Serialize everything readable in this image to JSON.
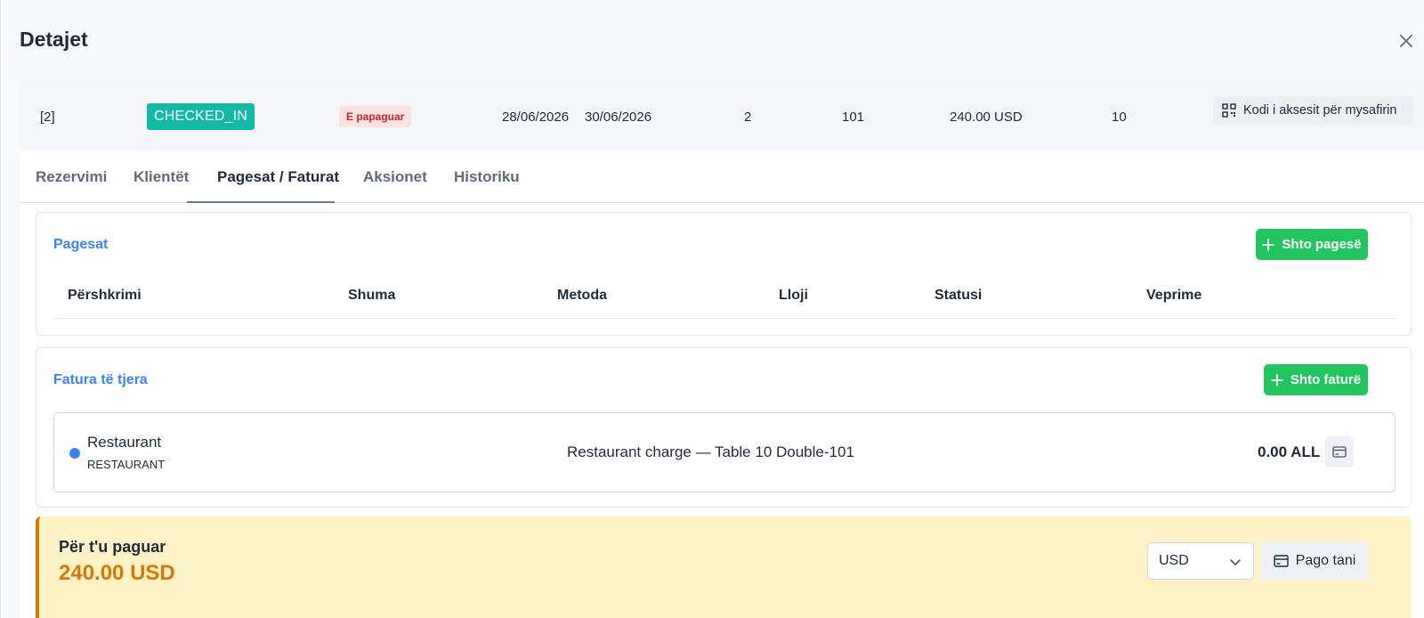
{
  "modal": {
    "title": "Detajet"
  },
  "summary": {
    "reservation_id": "[2]",
    "status": "CHECKED_IN",
    "payment_status": "E papaguar",
    "date_from": "28/06/2026",
    "date_to": "30/06/2026",
    "guests": "2",
    "room": "101",
    "price": "240.00 USD",
    "nights": "10",
    "access_code_label": "Kodi i aksesit për mysafirin"
  },
  "tabs": [
    {
      "label": "Rezervimi"
    },
    {
      "label": "Klientët"
    },
    {
      "label": "Pagesat / Faturat",
      "active": true
    },
    {
      "label": "Aksionet"
    },
    {
      "label": "Historiku"
    }
  ],
  "payments": {
    "title": "Pagesat",
    "add_label": "Shto pagesë",
    "columns": [
      "Përshkrimi",
      "Shuma",
      "Metoda",
      "Lloji",
      "Statusi",
      "Veprime"
    ]
  },
  "other_invoices": {
    "title": "Fatura të tjera",
    "add_label": "Shto faturë",
    "items": [
      {
        "name": "Restaurant",
        "type": "RESTAURANT",
        "description": "Restaurant charge — Table 10",
        "room": "Double-101",
        "amount": "0.00 ALL"
      }
    ]
  },
  "due": {
    "label": "Për t'u paguar",
    "amount": "240.00 USD",
    "currency": "USD",
    "pay_label": "Pago tani"
  },
  "colors": {
    "status_teal": "#14b8a6",
    "badge_red_bg": "#fde2e2",
    "badge_red_text": "#c0262d",
    "accent_blue": "#3b82f6",
    "action_green": "#22c55e",
    "due_bg": "#fef3c7",
    "due_accent": "#d97706"
  },
  "icons": {
    "close": "close-icon",
    "qr": "qr-code-icon",
    "plus": "plus-icon",
    "card": "credit-card-icon",
    "chevron": "chevron-down-icon"
  }
}
